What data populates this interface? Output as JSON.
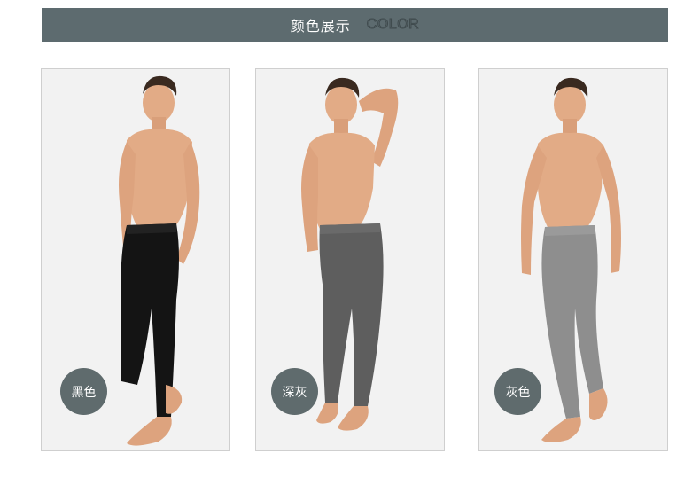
{
  "header": {
    "title_cn": "颜色展示",
    "title_en": "COLOR"
  },
  "colors": {
    "header_bg": "#5d6b6f",
    "badge_bg": "#5f6b6d",
    "skin": "#e2ab86",
    "black_pants": "#141414",
    "dark_gray_pants": "#5e5e5e",
    "gray_pants": "#8e8e8e"
  },
  "variants": [
    {
      "label": "黑色",
      "swatch": "#141414"
    },
    {
      "label": "深灰",
      "swatch": "#5e5e5e"
    },
    {
      "label": "灰色",
      "swatch": "#8e8e8e"
    }
  ]
}
